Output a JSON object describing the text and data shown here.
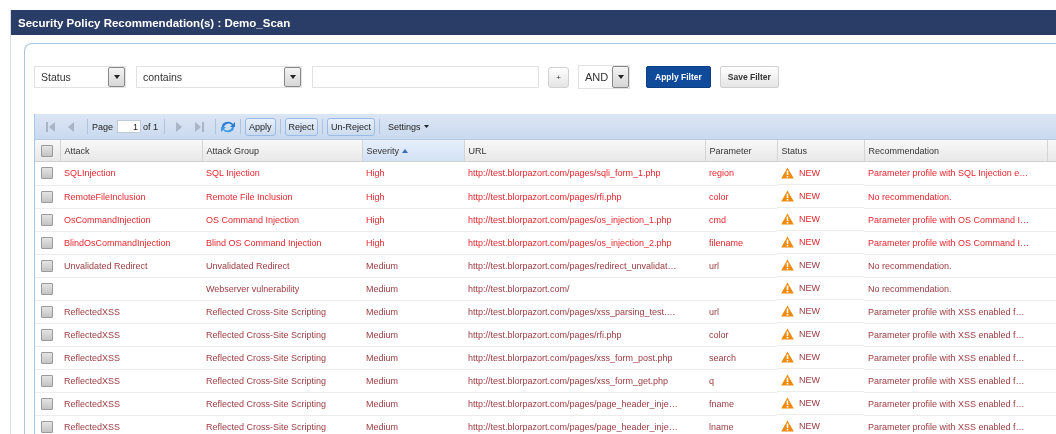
{
  "window": {
    "title": "Security Policy Recommendation(s) : Demo_Scan"
  },
  "filter": {
    "field_select": "Status",
    "operator_select": "contains",
    "add_button": "+",
    "logic_select": "AND",
    "buttons": [
      {
        "label": "Apply Filter",
        "kind": "primary"
      },
      {
        "label": "Save Filter",
        "kind": "default"
      }
    ]
  },
  "toolbar": {
    "nav_before": [
      {
        "kind": "first",
        "disabled": true
      },
      {
        "kind": "prev",
        "disabled": true
      }
    ],
    "page_label": "Page",
    "page_input": "1",
    "page_total": "of 1",
    "nav_after": [
      {
        "kind": "next",
        "disabled": true
      },
      {
        "kind": "last",
        "disabled": true
      }
    ],
    "buttons": [
      "Apply",
      "Reject",
      "Un-Reject"
    ],
    "settings": "Settings"
  },
  "table": {
    "all_checked": false,
    "columns": [
      {
        "label": "Attack",
        "sorted": false
      },
      {
        "label": "Attack Group",
        "sorted": false
      },
      {
        "label": "Severity",
        "sorted": true
      },
      {
        "label": "URL",
        "sorted": false
      },
      {
        "label": "Parameter",
        "sorted": false
      },
      {
        "label": "Status",
        "sorted": false
      },
      {
        "label": "Recommendation",
        "sorted": false
      }
    ],
    "rows": [
      {
        "checked": false,
        "kind": "high",
        "attack": "SQLInjection",
        "attack_group": "SQL Injection",
        "severity": "High",
        "url": "http://test.blorpazort.com/pages/sqli_form_1.php",
        "parameter": "region",
        "status": "NEW",
        "recommendation": "Parameter profile with SQL Injection e…"
      },
      {
        "checked": false,
        "kind": "high",
        "attack": "RemoteFileInclusion",
        "attack_group": "Remote File Inclusion",
        "severity": "High",
        "url": "http://test.blorpazort.com/pages/rfi.php",
        "parameter": "color",
        "status": "NEW",
        "recommendation": "No recommendation."
      },
      {
        "checked": false,
        "kind": "high",
        "attack": "OsCommandInjection",
        "attack_group": "OS Command Injection",
        "severity": "High",
        "url": "http://test.blorpazort.com/pages/os_injection_1.php",
        "parameter": "cmd",
        "status": "NEW",
        "recommendation": "Parameter profile with OS Command I…"
      },
      {
        "checked": false,
        "kind": "high",
        "attack": "BlindOsCommandInjection",
        "attack_group": "Blind OS Command Injection",
        "severity": "High",
        "url": "http://test.blorpazort.com/pages/os_injection_2.php",
        "parameter": "filename",
        "status": "NEW",
        "recommendation": "Parameter profile with OS Command I…"
      },
      {
        "checked": false,
        "kind": "medium",
        "attack": "Unvalidated Redirect",
        "attack_group": "Unvalidated Redirect",
        "severity": "Medium",
        "url": "http://test.blorpazort.com/pages/redirect_unvalidat…",
        "parameter": "url",
        "status": "NEW",
        "recommendation": "No recommendation."
      },
      {
        "checked": false,
        "kind": "medium",
        "attack_group": "Webserver vulnerability",
        "severity": "Medium",
        "url": "http://test.blorpazort.com/",
        "status": "NEW",
        "recommendation": "No recommendation."
      },
      {
        "checked": false,
        "kind": "medium",
        "attack": "ReflectedXSS",
        "attack_group": "Reflected Cross-Site Scripting",
        "severity": "Medium",
        "url": "http://test.blorpazort.com/pages/xss_parsing_test.…",
        "parameter": "url",
        "status": "NEW",
        "recommendation": "Parameter profile with XSS enabled f…"
      },
      {
        "checked": false,
        "kind": "medium",
        "attack": "ReflectedXSS",
        "attack_group": "Reflected Cross-Site Scripting",
        "severity": "Medium",
        "url": "http://test.blorpazort.com/pages/rfi.php",
        "parameter": "color",
        "status": "NEW",
        "recommendation": "Parameter profile with XSS enabled f…"
      },
      {
        "checked": false,
        "kind": "medium",
        "attack": "ReflectedXSS",
        "attack_group": "Reflected Cross-Site Scripting",
        "severity": "Medium",
        "url": "http://test.blorpazort.com/pages/xss_form_post.php",
        "parameter": "search",
        "status": "NEW",
        "recommendation": "Parameter profile with XSS enabled f…"
      },
      {
        "checked": false,
        "kind": "medium",
        "attack": "ReflectedXSS",
        "attack_group": "Reflected Cross-Site Scripting",
        "severity": "Medium",
        "url": "http://test.blorpazort.com/pages/xss_form_get.php",
        "parameter": "q",
        "status": "NEW",
        "recommendation": "Parameter profile with XSS enabled f…"
      },
      {
        "checked": false,
        "kind": "medium",
        "attack": "ReflectedXSS",
        "attack_group": "Reflected Cross-Site Scripting",
        "severity": "Medium",
        "url": "http://test.blorpazort.com/pages/page_header_inje…",
        "parameter": "fname",
        "status": "NEW",
        "recommendation": "Parameter profile with XSS enabled f…"
      },
      {
        "checked": false,
        "kind": "medium",
        "attack": "ReflectedXSS",
        "attack_group": "Reflected Cross-Site Scripting",
        "severity": "Medium",
        "url": "http://test.blorpazort.com/pages/page_header_inje…",
        "parameter": "lname",
        "status": "NEW",
        "recommendation": "Parameter profile with XSS enabled f…"
      }
    ]
  }
}
